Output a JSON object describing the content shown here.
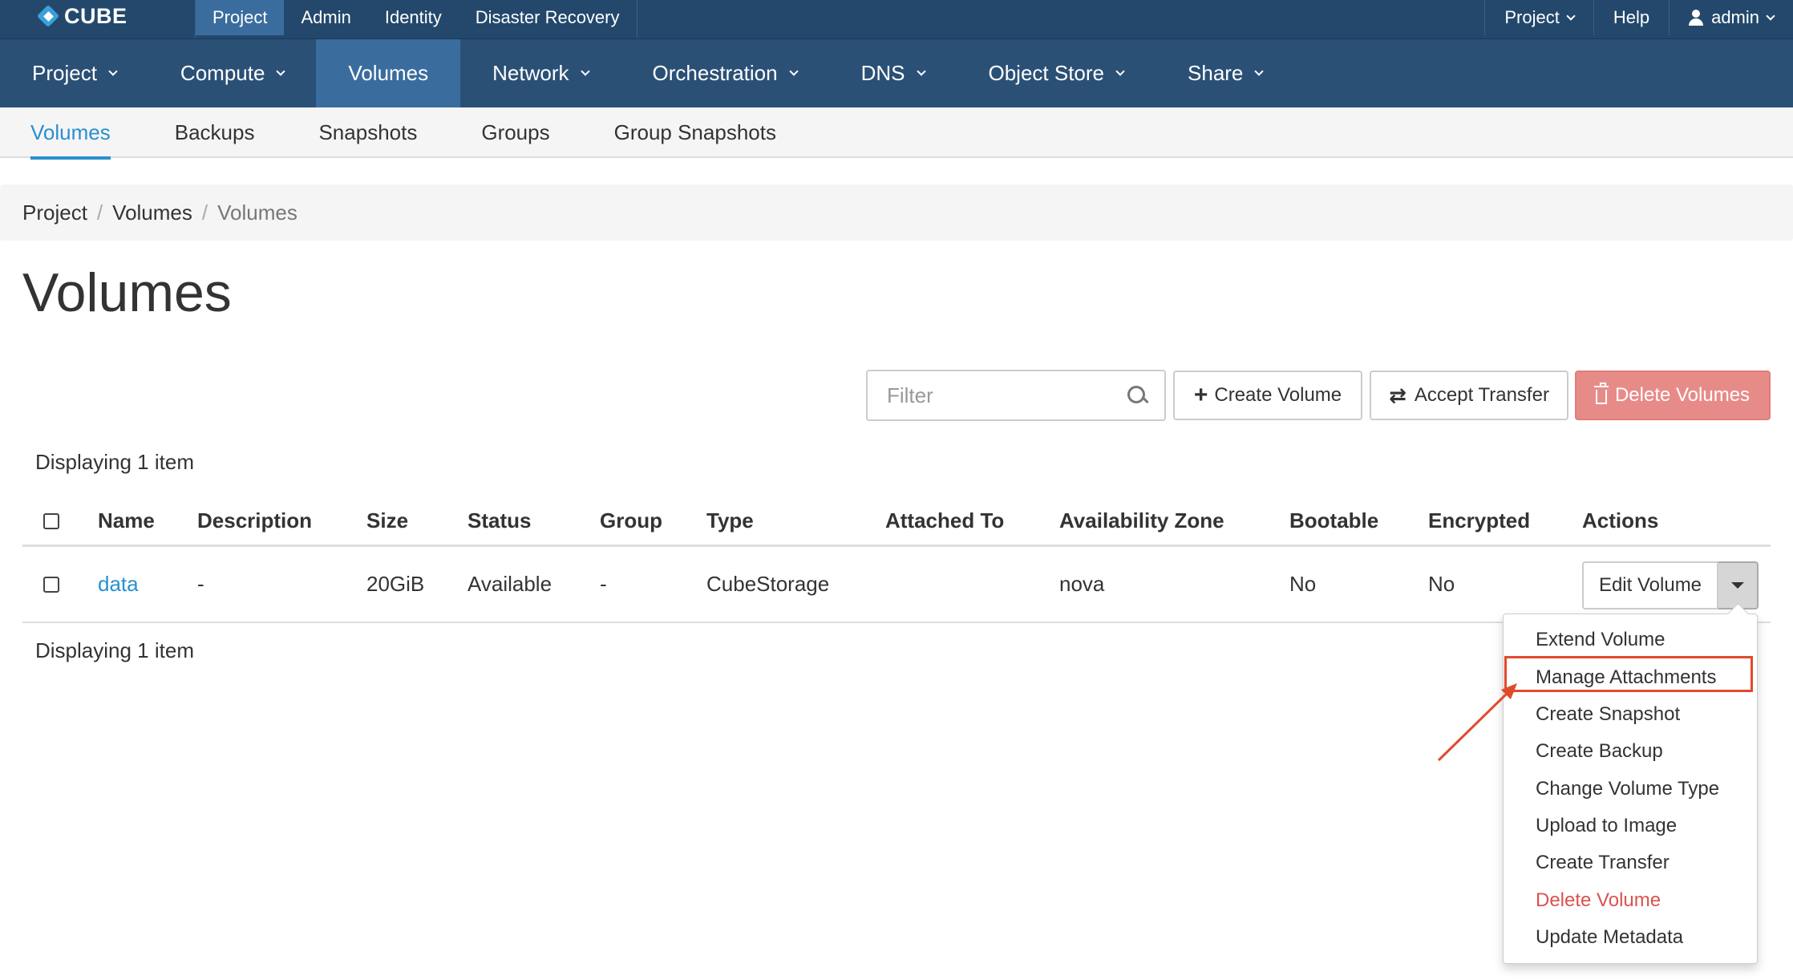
{
  "brand": {
    "logo_text": "CUBE"
  },
  "top_nav": {
    "left": [
      "Project",
      "Admin",
      "Identity",
      "Disaster Recovery"
    ],
    "active": "Project",
    "right": {
      "project": "Project",
      "help": "Help",
      "user": "admin"
    }
  },
  "main_nav": {
    "items": [
      "Project",
      "Compute",
      "Volumes",
      "Network",
      "Orchestration",
      "DNS",
      "Object Store",
      "Share"
    ],
    "active": "Volumes"
  },
  "sub_nav": {
    "items": [
      "Volumes",
      "Backups",
      "Snapshots",
      "Groups",
      "Group Snapshots"
    ],
    "active": "Volumes"
  },
  "breadcrumb": [
    "Project",
    "Volumes",
    "Volumes"
  ],
  "page": {
    "title": "Volumes"
  },
  "toolbar": {
    "filter_placeholder": "Filter",
    "create_label": "Create Volume",
    "accept_label": "Accept Transfer",
    "delete_label": "Delete Volumes"
  },
  "display_count": "Displaying 1 item",
  "table": {
    "columns": [
      "Name",
      "Description",
      "Size",
      "Status",
      "Group",
      "Type",
      "Attached To",
      "Availability Zone",
      "Bootable",
      "Encrypted",
      "Actions"
    ],
    "rows": [
      {
        "name": "data",
        "description": "-",
        "size": "20GiB",
        "status": "Available",
        "group": "-",
        "type": "CubeStorage",
        "attached_to": "",
        "availability_zone": "nova",
        "bootable": "No",
        "encrypted": "No",
        "action": "Edit Volume"
      }
    ]
  },
  "actions_menu": {
    "items": [
      "Extend Volume",
      "Manage Attachments",
      "Create Snapshot",
      "Create Backup",
      "Change Volume Type",
      "Upload to Image",
      "Create Transfer",
      "Delete Volume",
      "Update Metadata"
    ],
    "highlighted": "Manage Attachments",
    "danger": "Delete Volume"
  },
  "colors": {
    "topbar": "#23486c",
    "mainnav": "#2b5076",
    "active_nav": "#3a6d9e",
    "link": "#2a8fcf",
    "danger": "#d9534f",
    "annotation": "#e04a2b"
  }
}
